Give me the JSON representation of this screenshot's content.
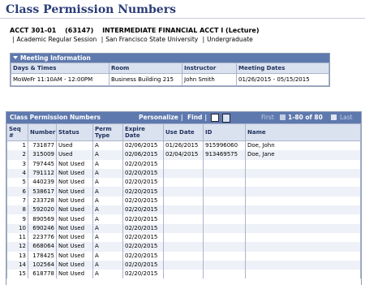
{
  "page": {
    "title": "Class Permission Numbers"
  },
  "course": {
    "code": "ACCT  301-01",
    "class_nbr": "(63147)",
    "title": "INTERMEDIATE FINANCIAL ACCT I (Lecture)",
    "session": "Academic Regular Session",
    "institution": "San Francisco State University",
    "career": "Undergraduate",
    "separator": "|"
  },
  "meeting": {
    "header": "Meeting Information",
    "columns": [
      "Days & Times",
      "Room",
      "Instructor",
      "Meeting Dates"
    ],
    "row": [
      "MoWeFr 11:10AM - 12:00PM",
      "Business Building 215",
      "John Smith",
      "01/26/2015 - 05/15/2015"
    ]
  },
  "permissions": {
    "header": "Class Permission Numbers",
    "personalize": "Personalize",
    "find": "Find",
    "separator": "|",
    "first": "First",
    "count": "1-80 of 80",
    "last": "Last",
    "icons": [
      "view-all-icon",
      "download-spreadsheet-icon",
      "previous-arrow-icon",
      "next-arrow-icon"
    ],
    "columns": [
      "Seq #",
      "Number",
      "Status",
      "Perm Type",
      "Expire Date",
      "Use Date",
      "ID",
      "Name"
    ],
    "rows": [
      [
        "1",
        "731877",
        "Used",
        "A",
        "02/06/2015",
        "01/26/2015",
        "915996060",
        "Doe, John"
      ],
      [
        "2",
        "315009",
        "Used",
        "A",
        "02/06/2015",
        "02/04/2015",
        "913469575",
        "Doe, Jane"
      ],
      [
        "3",
        "797445",
        "Not Used",
        "A",
        "02/20/2015",
        "",
        "",
        ""
      ],
      [
        "4",
        "791112",
        "Not Used",
        "A",
        "02/20/2015",
        "",
        "",
        ""
      ],
      [
        "5",
        "440239",
        "Not Used",
        "A",
        "02/20/2015",
        "",
        "",
        ""
      ],
      [
        "6",
        "538617",
        "Not Used",
        "A",
        "02/20/2015",
        "",
        "",
        ""
      ],
      [
        "7",
        "233728",
        "Not Used",
        "A",
        "02/20/2015",
        "",
        "",
        ""
      ],
      [
        "8",
        "592020",
        "Not Used",
        "A",
        "02/20/2015",
        "",
        "",
        ""
      ],
      [
        "9",
        "890569",
        "Not Used",
        "A",
        "02/20/2015",
        "",
        "",
        ""
      ],
      [
        "10",
        "690246",
        "Not Used",
        "A",
        "02/20/2015",
        "",
        "",
        ""
      ],
      [
        "11",
        "223776",
        "Not Used",
        "A",
        "02/20/2015",
        "",
        "",
        ""
      ],
      [
        "12",
        "668064",
        "Not Used",
        "A",
        "02/20/2015",
        "",
        "",
        ""
      ],
      [
        "13",
        "178425",
        "Not Used",
        "A",
        "02/20/2015",
        "",
        "",
        ""
      ],
      [
        "14",
        "102564",
        "Not Used",
        "A",
        "02/20/2015",
        "",
        "",
        ""
      ],
      [
        "15",
        "618778",
        "Not Used",
        "A",
        "02/20/2015",
        "",
        "",
        ""
      ]
    ]
  },
  "colors": {
    "title": "#2b3d78",
    "grid_header": "#5e79ae",
    "column_header": "#dbe2ef",
    "row_alt": "#eef1f7"
  }
}
